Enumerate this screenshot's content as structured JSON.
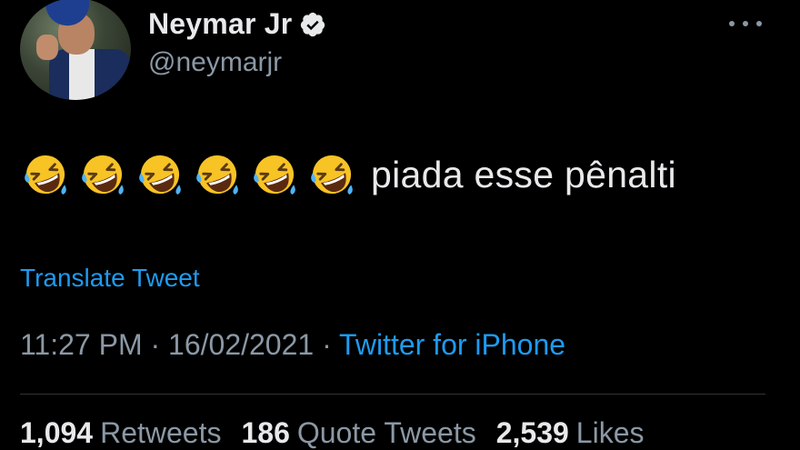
{
  "author": {
    "display_name": "Neymar Jr",
    "handle": "@neymarjr",
    "verified_icon": "verified-badge-icon",
    "avatar_icon": "profile-avatar"
  },
  "more_icon": "more-horizontal-icon",
  "tweet": {
    "emoji_icon": "rolling-on-floor-laughing-emoji",
    "emoji_count": 6,
    "text": "piada esse pênalti"
  },
  "translate_label": "Translate Tweet",
  "meta": {
    "time": "11:27 PM",
    "separator1": " · ",
    "date": "16/02/2021",
    "separator2": " · ",
    "source": "Twitter for iPhone"
  },
  "stats": {
    "retweets_count": "1,094",
    "retweets_label": "Retweets",
    "quotes_count": "186",
    "quotes_label": "Quote Tweets",
    "likes_count": "2,539",
    "likes_label": "Likes"
  },
  "colors": {
    "background": "#000000",
    "text": "#e7e9ea",
    "secondary": "#8b98a5",
    "link": "#1d9bf0"
  }
}
